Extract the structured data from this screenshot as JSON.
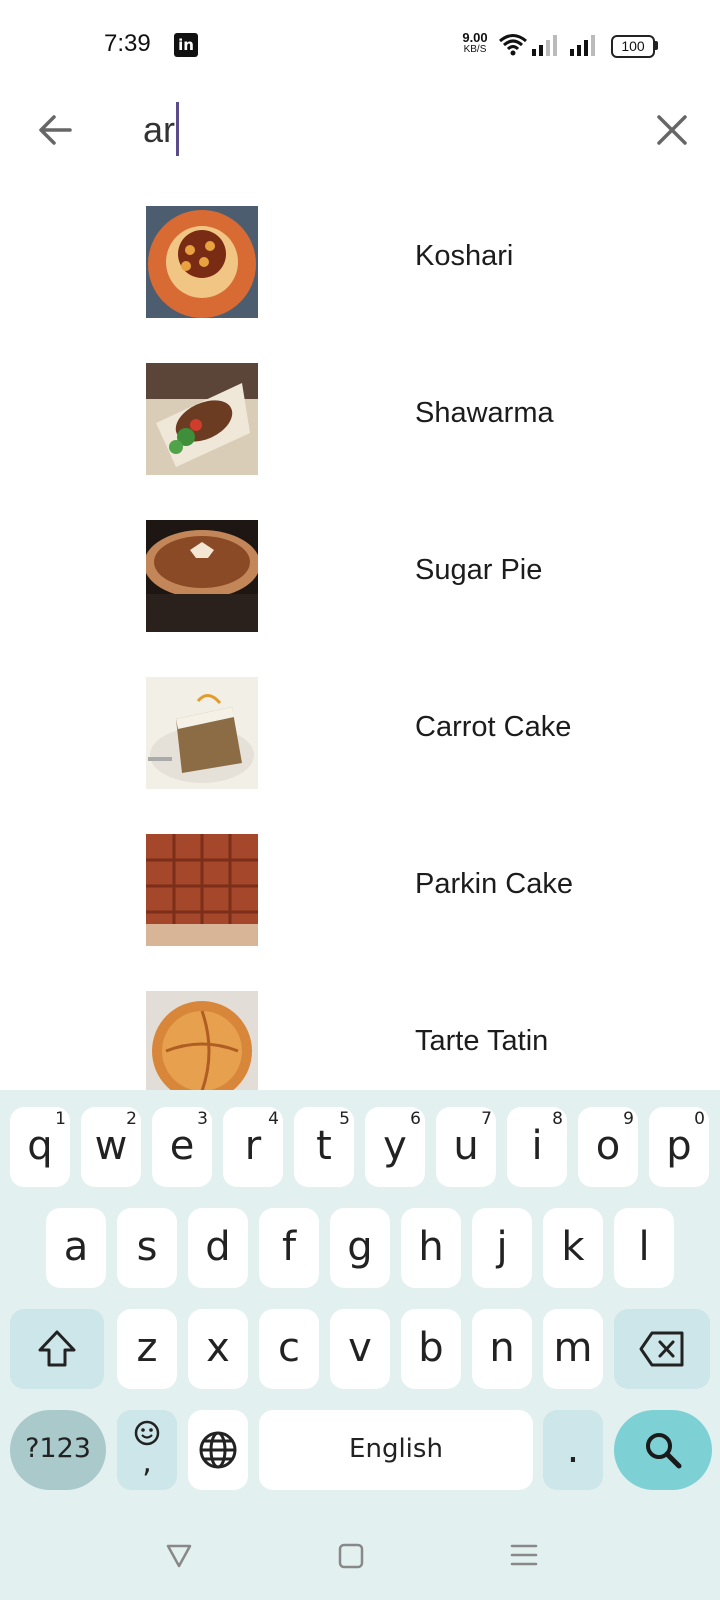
{
  "status_bar": {
    "time": "7:39",
    "notification_app": "in",
    "net_speed_value": "9.00",
    "net_speed_unit": "KB/S",
    "battery": "100"
  },
  "search": {
    "query": "ar"
  },
  "results": [
    {
      "name": "Koshari",
      "thumb_colors": [
        "#c9582a",
        "#e8a23f",
        "#7a2b14"
      ]
    },
    {
      "name": "Shawarma",
      "thumb_colors": [
        "#d9cdb8",
        "#6b3b22",
        "#3f8f3a"
      ]
    },
    {
      "name": "Sugar Pie",
      "thumb_colors": [
        "#1e1613",
        "#9a5a32",
        "#c28659"
      ]
    },
    {
      "name": "Carrot Cake",
      "thumb_colors": [
        "#e9e5df",
        "#8c6c44",
        "#f2efe6"
      ]
    },
    {
      "name": "Parkin Cake",
      "thumb_colors": [
        "#a5472a",
        "#7b2e1a",
        "#c6643e"
      ]
    },
    {
      "name": "Tarte Tatin",
      "thumb_colors": [
        "#e2ddd6",
        "#d8863a",
        "#b05d24"
      ]
    }
  ],
  "keyboard": {
    "row1": [
      {
        "letter": "q",
        "hint": "1"
      },
      {
        "letter": "w",
        "hint": "2"
      },
      {
        "letter": "e",
        "hint": "3"
      },
      {
        "letter": "r",
        "hint": "4"
      },
      {
        "letter": "t",
        "hint": "5"
      },
      {
        "letter": "y",
        "hint": "6"
      },
      {
        "letter": "u",
        "hint": "7"
      },
      {
        "letter": "i",
        "hint": "8"
      },
      {
        "letter": "o",
        "hint": "9"
      },
      {
        "letter": "p",
        "hint": "0"
      }
    ],
    "row2": [
      "a",
      "s",
      "d",
      "f",
      "g",
      "h",
      "j",
      "k",
      "l"
    ],
    "row3": [
      "z",
      "x",
      "c",
      "v",
      "b",
      "n",
      "m"
    ],
    "symbols_label": "?123",
    "emoji_comma": ",",
    "space_label": "English",
    "period_label": ".",
    "colors": {
      "background": "#e3f0f0",
      "key": "#ffffff",
      "special": "#cde6e9",
      "search": "#7dd0d3"
    }
  },
  "icons": {
    "back": "arrow-left-icon",
    "clear": "close-icon",
    "shift": "shift-icon",
    "backspace": "backspace-icon",
    "emoji": "emoji-icon",
    "globe": "globe-icon",
    "search": "search-icon"
  }
}
